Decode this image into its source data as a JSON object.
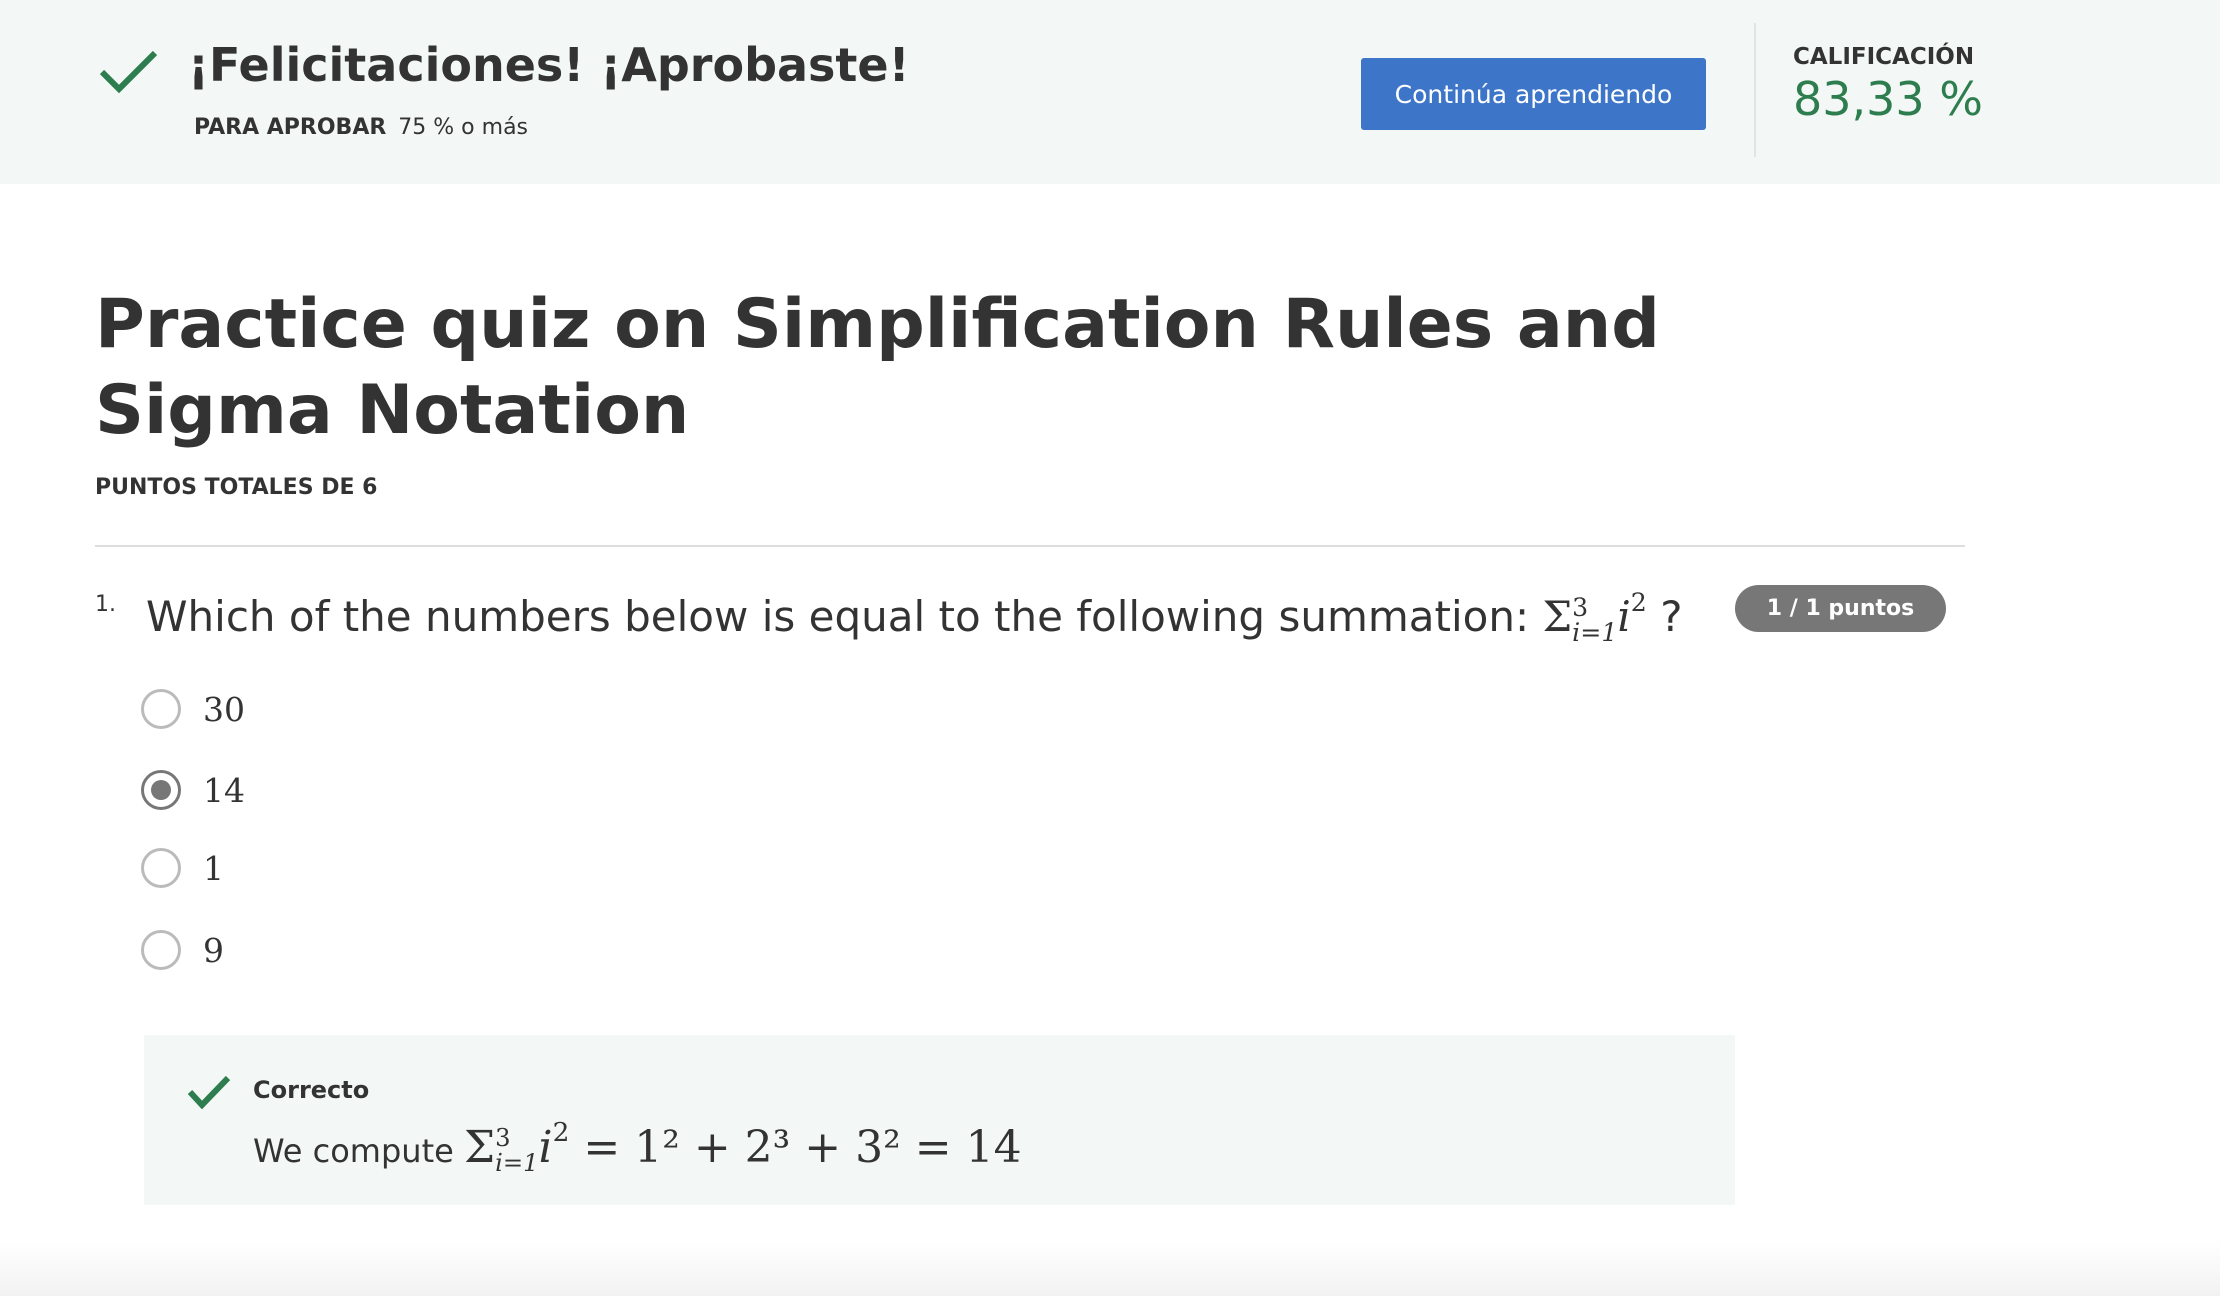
{
  "header": {
    "title": "¡Felicitaciones! ¡Aprobaste!",
    "pass_label": "PARA APROBAR",
    "pass_value": "75 % o más",
    "continue_button": "Continúa aprendiendo",
    "grade_label": "CALIFICACIÓN",
    "grade_value": "83,33 %",
    "accent_color": "#2e7d4f",
    "button_color": "#3d75c8"
  },
  "quiz": {
    "title": "Practice quiz on Simplification Rules and Sigma Notation",
    "total_points": "PUNTOS TOTALES DE 6",
    "questions": [
      {
        "number": "1.",
        "text": "Which of the numbers below is equal to the following summation:",
        "math": {
          "sigma": "Σ",
          "upper": "3",
          "lower": "i=1",
          "term": "i",
          "exp": "2",
          "suffix": "?"
        },
        "score": "1 / 1 puntos",
        "options": [
          {
            "label": "30",
            "selected": false
          },
          {
            "label": "14",
            "selected": true
          },
          {
            "label": "1",
            "selected": false
          },
          {
            "label": "9",
            "selected": false
          }
        ],
        "feedback": {
          "status": "Correcto",
          "prefix": "We compute",
          "equation": "= 1² + 2³ + 3² = 14"
        }
      }
    ]
  }
}
